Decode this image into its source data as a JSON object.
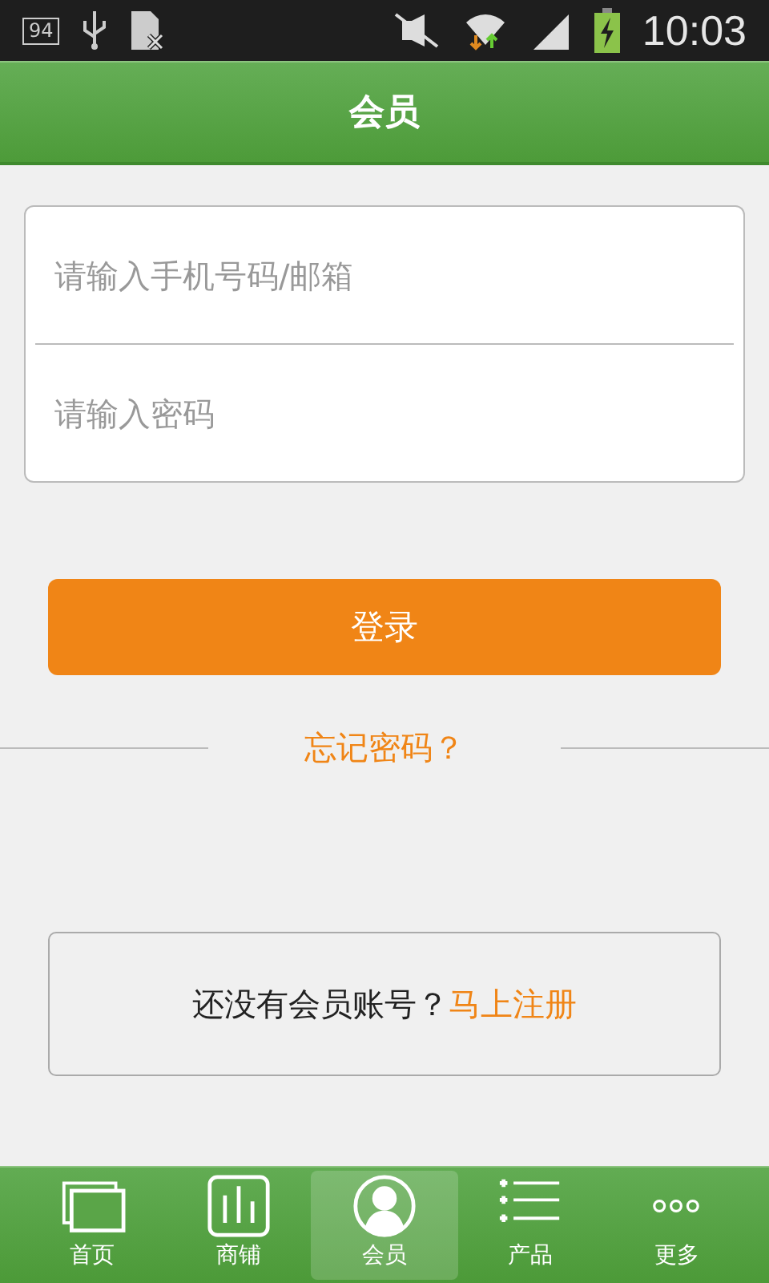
{
  "status_bar": {
    "battery_badge": "94",
    "time": "10:03"
  },
  "header": {
    "title": "会员"
  },
  "form": {
    "fields": [
      {
        "placeholder": "请输入手机号码/邮箱"
      },
      {
        "placeholder": "请输入密码"
      }
    ]
  },
  "login_button": "登录",
  "forgot_link": "忘记密码？",
  "register": {
    "text": "还没有会员账号？",
    "link": "马上注册"
  },
  "tabs": [
    {
      "label": "首页",
      "selected": false
    },
    {
      "label": "商铺",
      "selected": false
    },
    {
      "label": "会员",
      "selected": true
    },
    {
      "label": "产品",
      "selected": false
    },
    {
      "label": "更多",
      "selected": false
    }
  ]
}
